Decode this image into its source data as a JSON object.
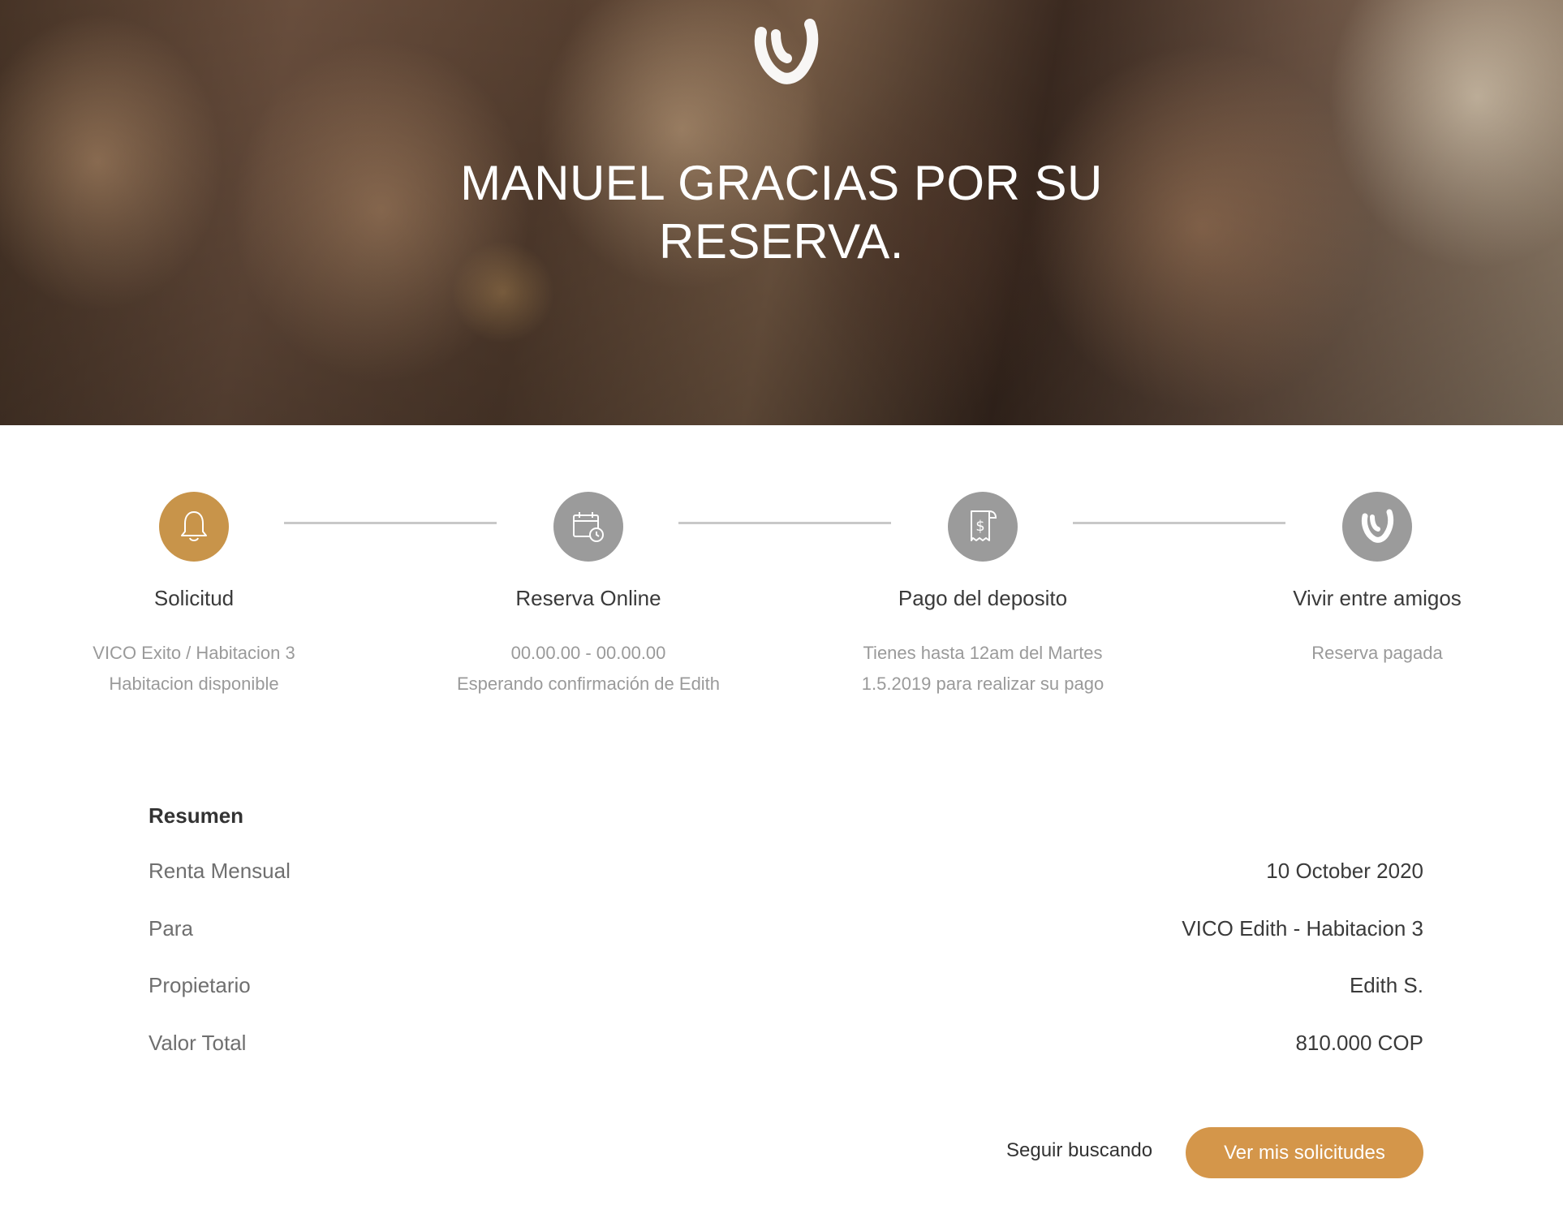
{
  "hero": {
    "logo_icon": "vico-logo-icon",
    "title_line1": "MANUEL GRACIAS POR SU",
    "title_line2": "RESERVA."
  },
  "steps": [
    {
      "title": "Solicitud",
      "icon": "bell-icon",
      "active": true,
      "desc_line1": "VICO Exito / Habitacion 3",
      "desc_line2": "Habitacion disponible"
    },
    {
      "title": "Reserva Online",
      "icon": "calendar-clock-icon",
      "active": false,
      "desc_line1": "00.00.00 - 00.00.00",
      "desc_line2": "Esperando confirmación de Edith"
    },
    {
      "title": "Pago del deposito",
      "icon": "receipt-dollar-icon",
      "active": false,
      "desc_line1": "Tienes hasta 12am del Martes",
      "desc_line2": "1.5.2019 para realizar su pago"
    },
    {
      "title": "Vivir entre amigos",
      "icon": "vico-logo-icon",
      "active": false,
      "desc_line1": "Reserva pagada",
      "desc_line2": ""
    }
  ],
  "summary": {
    "heading": "Resumen",
    "rows": [
      {
        "label": "Renta Mensual",
        "value": "10 October 2020"
      },
      {
        "label": "Para",
        "value": "VICO Edith - Habitacion 3"
      },
      {
        "label": "Propietario",
        "value": "Edith S."
      },
      {
        "label": "Valor Total",
        "value": "810.000 COP"
      }
    ]
  },
  "actions": {
    "secondary_label": "Seguir buscando",
    "primary_label": "Ver mis solicitudes"
  },
  "colors": {
    "accent": "#d4964a",
    "step_active": "#c8944a",
    "step_inactive": "#9b9b9b"
  }
}
